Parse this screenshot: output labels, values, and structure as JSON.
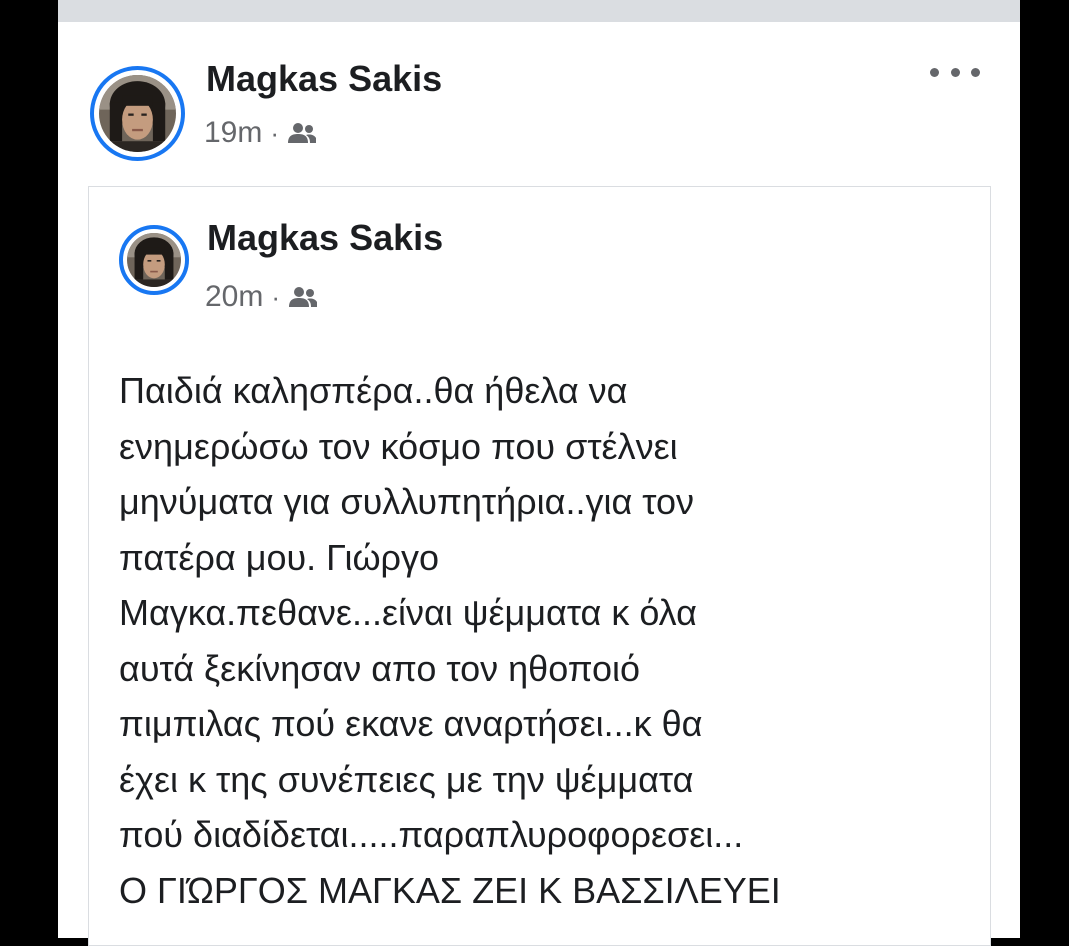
{
  "post": {
    "author": "Magkas Sakis",
    "time": "19m",
    "separator": "·",
    "audience_icon": "group-audience-icon",
    "more_icon": "more-options-icon"
  },
  "shared_post": {
    "author": "Magkas Sakis",
    "time": "20m",
    "separator": "·",
    "audience_icon": "group-audience-icon",
    "text_lines": [
      "Παιδιά καλησπέρα..θα ήθελα να",
      "ενημερώσω τον κόσμο που στέλνει",
      "μηνύματα για συλλυπητήρια..για τον",
      "πατέρα μου. Γιώργο",
      "Μαγκα.πεθανε...είναι ψέμματα κ όλα",
      "αυτά ξεκίνησαν απο τον ηθοποιό",
      "πιμπιλας πού εκανε αναρτήσει...κ θα",
      "έχει κ της συνέπειες με την ψέμματα",
      "πού διαδίδεται.....παραπλυροφορεσει...",
      "Ο ΓΙΏΡΓΟΣ ΜΑΓΚΑΣ ΖΕΙ Κ ΒΑΣΣΙΛΕΥΕΙ"
    ]
  },
  "colors": {
    "accent": "#1877f2",
    "text_primary": "#1c1e21",
    "text_secondary": "#65676b",
    "border": "#dadde1"
  }
}
